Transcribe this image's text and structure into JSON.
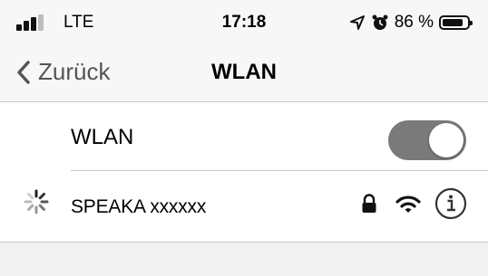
{
  "status_bar": {
    "carrier": "LTE",
    "time": "17:18",
    "battery_percent": "86 %",
    "battery_level": 0.86
  },
  "nav": {
    "back_label": "Zurück",
    "title": "WLAN"
  },
  "wifi_toggle": {
    "label": "WLAN",
    "state": "on"
  },
  "networks": [
    {
      "name": "SPEAKA xxxxxx",
      "icons": [
        "loading-spinner-icon",
        "lock-icon",
        "wifi-signal-icon",
        "info-icon"
      ]
    }
  ],
  "colors": {
    "toggle_on": "#7a7a7a",
    "background": "#f2f2f2",
    "list_background": "#ffffff",
    "text": "#000000",
    "back_link": "#555555"
  }
}
